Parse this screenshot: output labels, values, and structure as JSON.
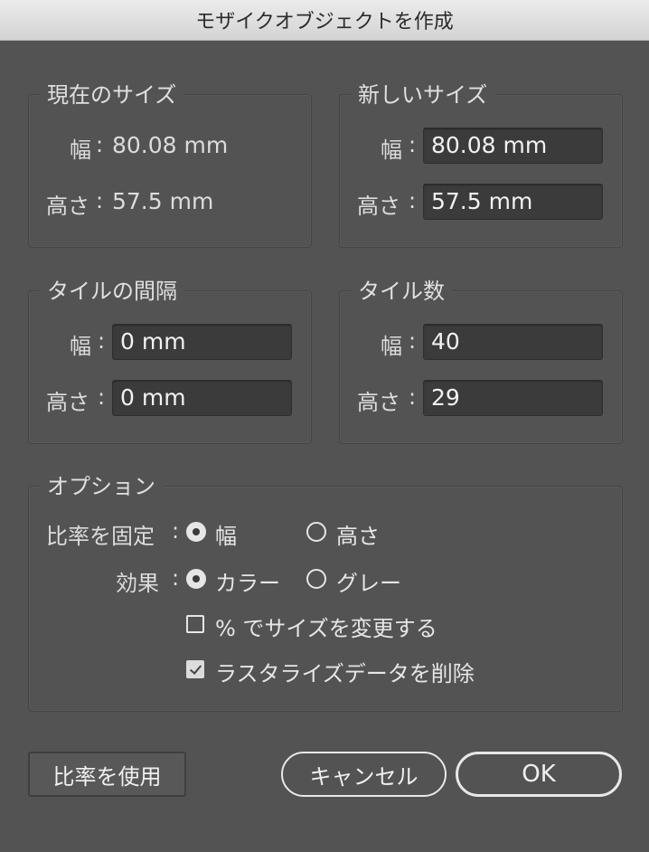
{
  "window": {
    "title": "モザイクオブジェクトを作成"
  },
  "current_size": {
    "legend": "現在のサイズ",
    "width_label": "幅",
    "width_value": "80.08 mm",
    "height_label": "高さ",
    "height_value": "57.5 mm"
  },
  "new_size": {
    "legend": "新しいサイズ",
    "width_label": "幅",
    "width_value": "80.08 mm",
    "height_label": "高さ",
    "height_value": "57.5 mm"
  },
  "tile_spacing": {
    "legend": "タイルの間隔",
    "width_label": "幅",
    "width_value": "0 mm",
    "height_label": "高さ",
    "height_value": "0 mm"
  },
  "tile_count": {
    "legend": "タイル数",
    "width_label": "幅",
    "width_value": "40",
    "height_label": "高さ",
    "height_value": "29"
  },
  "options": {
    "legend": "オプション",
    "constrain_label": "比率を固定",
    "constrain_width": "幅",
    "constrain_height": "高さ",
    "constrain_selected": "幅",
    "result_label": "効果",
    "result_color": "カラー",
    "result_gray": "グレー",
    "result_selected": "カラー",
    "resize_percent_label": "% でサイズを変更する",
    "resize_percent_checked": false,
    "delete_raster_label": "ラスタライズデータを削除",
    "delete_raster_checked": true
  },
  "buttons": {
    "use_ratio": "比率を使用",
    "cancel": "キャンセル",
    "ok": "OK"
  }
}
